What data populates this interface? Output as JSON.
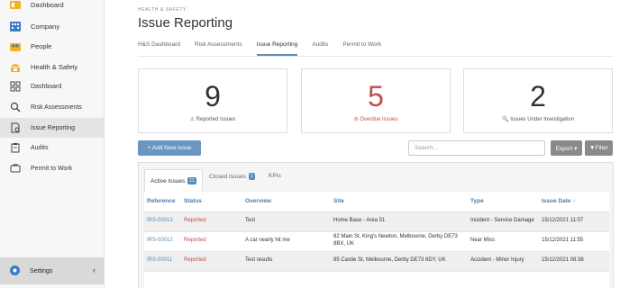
{
  "sidebar": {
    "items": [
      {
        "label": "Dashboard",
        "icon": "dashboard-icon",
        "color": "#f0b323"
      },
      {
        "label": "Company",
        "icon": "company-icon",
        "color": "#3b7cc4"
      },
      {
        "label": "People",
        "icon": "people-icon",
        "color": "#f0b323"
      },
      {
        "label": "Health & Safety",
        "icon": "health-safety-icon",
        "color": "#f0b323"
      },
      {
        "label": "Dashboard",
        "icon": "grid-icon"
      },
      {
        "label": "Risk Assessments",
        "icon": "magnifier-icon"
      },
      {
        "label": "Issue Reporting",
        "icon": "issue-icon"
      },
      {
        "label": "Audits",
        "icon": "clipboard-icon"
      },
      {
        "label": "Permit to Work",
        "icon": "permit-icon"
      }
    ],
    "settings": {
      "label": "Settings",
      "icon": "gear-icon",
      "chevron": "‹"
    }
  },
  "header": {
    "breadcrumb": "HEALTH & SAFETY",
    "title": "Issue Reporting"
  },
  "tabs": [
    "H&S Dashboard",
    "Risk Assessments",
    "Issue Reporting",
    "Audits",
    "Permit to Work"
  ],
  "active_tab": "Issue Reporting",
  "stats": [
    {
      "value": "9",
      "caption": "⚠ Reported Issues",
      "color": "#333333"
    },
    {
      "value": "5",
      "caption": "⊘ Overdue Issues",
      "color": "#c94a4a"
    },
    {
      "value": "2",
      "caption": "🔍 Issues Under Investigation",
      "color": "#333333"
    }
  ],
  "actions": {
    "add_label": "+ Add New Issue",
    "search_placeholder": "Search...",
    "export_label": "Export ▾",
    "filter_label": "▼Filter"
  },
  "panel_tabs": {
    "active": {
      "label": "Active Issues",
      "count": "11"
    },
    "closed": {
      "label": "Closed Issues",
      "count": "1"
    },
    "kpis": {
      "label": "KPIs"
    }
  },
  "table": {
    "headers": [
      "Reference",
      "Status",
      "Overview",
      "Site",
      "Type",
      "Issue Date ↑"
    ],
    "rows": [
      [
        "IRS-00013",
        "Reported",
        "Test",
        "Home Base - Area 51",
        "Incident - Service Damage",
        "15/12/2021 11:57"
      ],
      [
        "IRS-00012",
        "Reported",
        "A car nearly hit me",
        "82 Main St, King's Newton, Melbourne, Derby DE73 8BX, UK",
        "Near Miss",
        "15/12/2021 11:55"
      ],
      [
        "IRS-00011",
        "Reported",
        "Test results",
        "85 Castle St, Melbourne, Derby DE73 8DY, UK",
        "Accident - Minor Injury",
        "15/12/2021 08:38"
      ]
    ]
  },
  "colors": {
    "accent": "#5b8db8",
    "danger": "#c94a4a",
    "button_grey": "#8a8a8a"
  }
}
